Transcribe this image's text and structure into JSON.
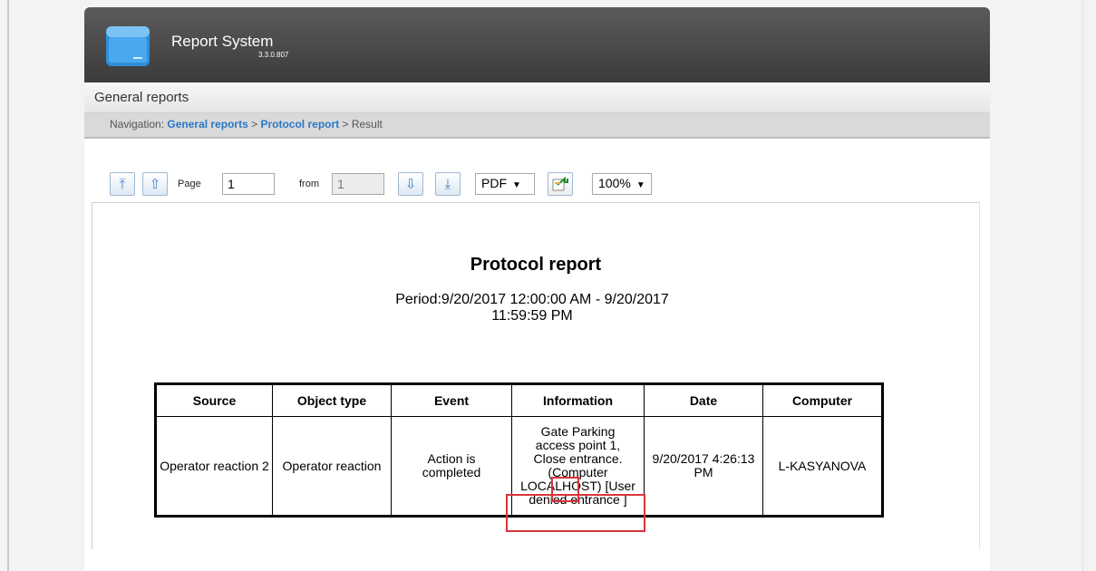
{
  "app": {
    "title": "Report System",
    "version": "3.3.0.807"
  },
  "section": {
    "title": "General reports"
  },
  "breadcrumb": {
    "prefix": "Navigation:",
    "items": [
      "General reports",
      "Protocol report"
    ],
    "separator": ">",
    "current": "Result"
  },
  "toolbar": {
    "page_label": "Page",
    "page_value": "1",
    "from_label": "from",
    "total_pages": "1",
    "format_value": "PDF",
    "zoom_value": "100%"
  },
  "report": {
    "title": "Protocol report",
    "period_line1": "Period:9/20/2017 12:00:00 AM - 9/20/2017",
    "period_line2": "11:59:59 PM",
    "columns": [
      "Source",
      "Object type",
      "Event",
      "Information",
      "Date",
      "Computer"
    ],
    "rows": [
      {
        "source": "Operator reaction 2",
        "object_type": "Operator reaction",
        "event": "Action is completed",
        "information": "Gate Parking access point 1, Close entrance. (Computer LOCALHOST) [User denied entrance ]",
        "date": "9/20/2017 4:26:13 PM",
        "computer": "L-KASYANOVA"
      }
    ]
  },
  "colors": {
    "header_dark": "#3b3b3b",
    "link_blue": "#2a79c9",
    "highlight_red": "#d9353c"
  }
}
